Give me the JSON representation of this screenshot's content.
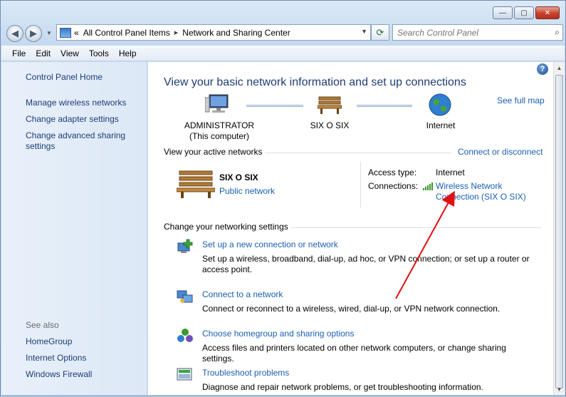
{
  "window": {
    "min_label": "—",
    "max_label": "▢",
    "close_label": "✕"
  },
  "address": {
    "chevrons": "«",
    "crumb1": "All Control Panel Items",
    "separator": "▸",
    "crumb2": "Network and Sharing Center",
    "search_placeholder": "Search Control Panel"
  },
  "menu": [
    "File",
    "Edit",
    "View",
    "Tools",
    "Help"
  ],
  "sidebar": {
    "home": "Control Panel Home",
    "items": [
      "Manage wireless networks",
      "Change adapter settings",
      "Change advanced sharing settings"
    ],
    "see_also_label": "See also",
    "see_also": [
      "HomeGroup",
      "Internet Options",
      "Windows Firewall"
    ]
  },
  "main": {
    "help": "?",
    "title": "View your basic network information and set up connections",
    "see_full_map": "See full map",
    "map": {
      "computer_line1": "ADMINISTRATOR",
      "computer_line2": "(This computer)",
      "network": "SIX O SIX",
      "internet": "Internet"
    },
    "active_networks_header": "View your active networks",
    "connect_or_disconnect": "Connect or disconnect",
    "active": {
      "name": "SIX O SIX",
      "type": "Public network",
      "access_type_label": "Access type:",
      "access_type_value": "Internet",
      "connections_label": "Connections:",
      "connection_line1": "Wireless Network",
      "connection_line2": "Connection (SIX O SIX)"
    },
    "settings_header": "Change your networking settings",
    "tasks": [
      {
        "title": "Set up a new connection or network",
        "desc": "Set up a wireless, broadband, dial-up, ad hoc, or VPN connection; or set up a router or access point."
      },
      {
        "title": "Connect to a network",
        "desc": "Connect or reconnect to a wireless, wired, dial-up, or VPN network connection."
      },
      {
        "title": "Choose homegroup and sharing options",
        "desc": "Access files and printers located on other network computers, or change sharing settings."
      },
      {
        "title": "Troubleshoot problems",
        "desc": "Diagnose and repair network problems, or get troubleshooting information."
      }
    ]
  },
  "colors": {
    "link": "#1a5fb4",
    "title": "#1e3d74",
    "annotation_arrow": "#e01010"
  }
}
